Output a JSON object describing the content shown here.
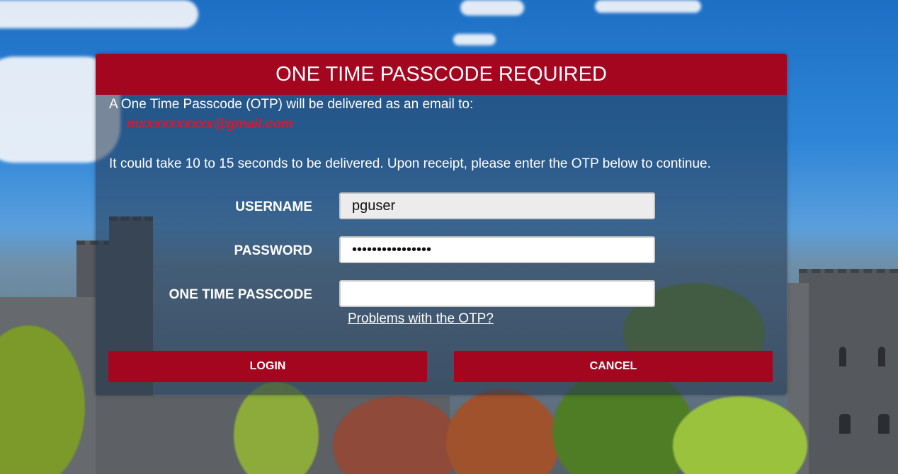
{
  "dialog": {
    "title": "ONE TIME PASSCODE REQUIRED",
    "intro": "A One Time Passcode (OTP) will be delivered as an email to:",
    "email": "mxxxxxxxxxx@gmail.com",
    "note": "It could take 10 to 15 seconds to be delivered. Upon receipt, please enter the OTP below to continue."
  },
  "form": {
    "username_label": "USERNAME",
    "username_value": "pguser",
    "password_label": "PASSWORD",
    "password_value": "••••••••••••••••",
    "otp_label": "ONE TIME PASSCODE",
    "otp_value": "",
    "otp_help_link": "Problems with the OTP?"
  },
  "buttons": {
    "login_label": "LOGIN",
    "cancel_label": "CANCEL"
  },
  "colors": {
    "accent": "#a4061f",
    "email_text": "#e2142b",
    "overlay": "#20344e"
  }
}
